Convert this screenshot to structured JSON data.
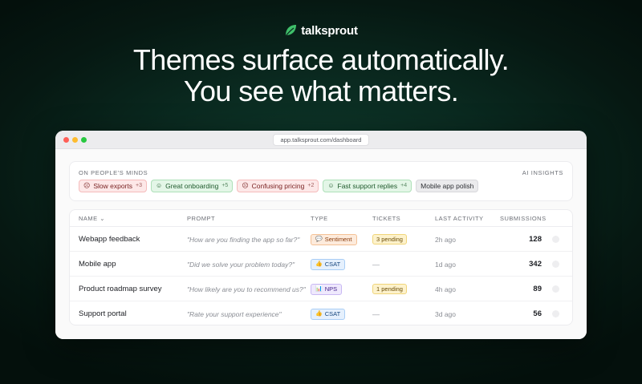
{
  "brand": {
    "name": "talksprout",
    "logo_icon": "leaf-icon",
    "logo_color": "#3fbf6a"
  },
  "headline": {
    "line1": "Themes surface automatically.",
    "line2": "You see what matters."
  },
  "browser": {
    "url": "app.talksprout.com/dashboard"
  },
  "minds": {
    "title": "ON PEOPLE'S MINDS",
    "ai_label": "AI INSIGHTS",
    "chips": [
      {
        "label": "Slow exports",
        "count": "+3",
        "sentiment": "negative",
        "icon": "frown-face-icon"
      },
      {
        "label": "Great onboarding",
        "count": "+5",
        "sentiment": "positive",
        "icon": "smile-face-icon"
      },
      {
        "label": "Confusing pricing",
        "count": "+2",
        "sentiment": "negative",
        "icon": "frown-face-icon"
      },
      {
        "label": "Fast support replies",
        "count": "+4",
        "sentiment": "positive",
        "icon": "smile-face-icon"
      },
      {
        "label": "Mobile app polish",
        "count": "",
        "sentiment": "neutral",
        "icon": ""
      }
    ]
  },
  "table": {
    "headers": {
      "name": "NAME",
      "sort_icon": "⌄",
      "prompt": "PROMPT",
      "type": "TYPE",
      "tickets": "TICKETS",
      "last_activity": "LAST ACTIVITY",
      "submissions": "SUBMISSIONS"
    },
    "rows": [
      {
        "name": "Webapp feedback",
        "prompt": "\"How are you finding the app so far?\"",
        "type": "Sentiment",
        "type_kind": "sentiment",
        "type_icon": "chat-bubble-icon",
        "tickets": "3 pending",
        "tickets_pending": true,
        "last_activity": "2h ago",
        "submissions": "128"
      },
      {
        "name": "Mobile app",
        "prompt": "\"Did we solve your problem today?\"",
        "type": "CSAT",
        "type_kind": "csat",
        "type_icon": "thumbs-up-icon",
        "tickets": "—",
        "tickets_pending": false,
        "last_activity": "1d ago",
        "submissions": "342"
      },
      {
        "name": "Product roadmap survey",
        "prompt": "\"How likely are you to recommend us?\"",
        "type": "NPS",
        "type_kind": "nps",
        "type_icon": "bar-chart-icon",
        "tickets": "1 pending",
        "tickets_pending": true,
        "last_activity": "4h ago",
        "submissions": "89"
      },
      {
        "name": "Support portal",
        "prompt": "\"Rate your support experience\"",
        "type": "CSAT",
        "type_kind": "csat",
        "type_icon": "thumbs-up-icon",
        "tickets": "—",
        "tickets_pending": false,
        "last_activity": "3d ago",
        "submissions": "56"
      }
    ]
  }
}
